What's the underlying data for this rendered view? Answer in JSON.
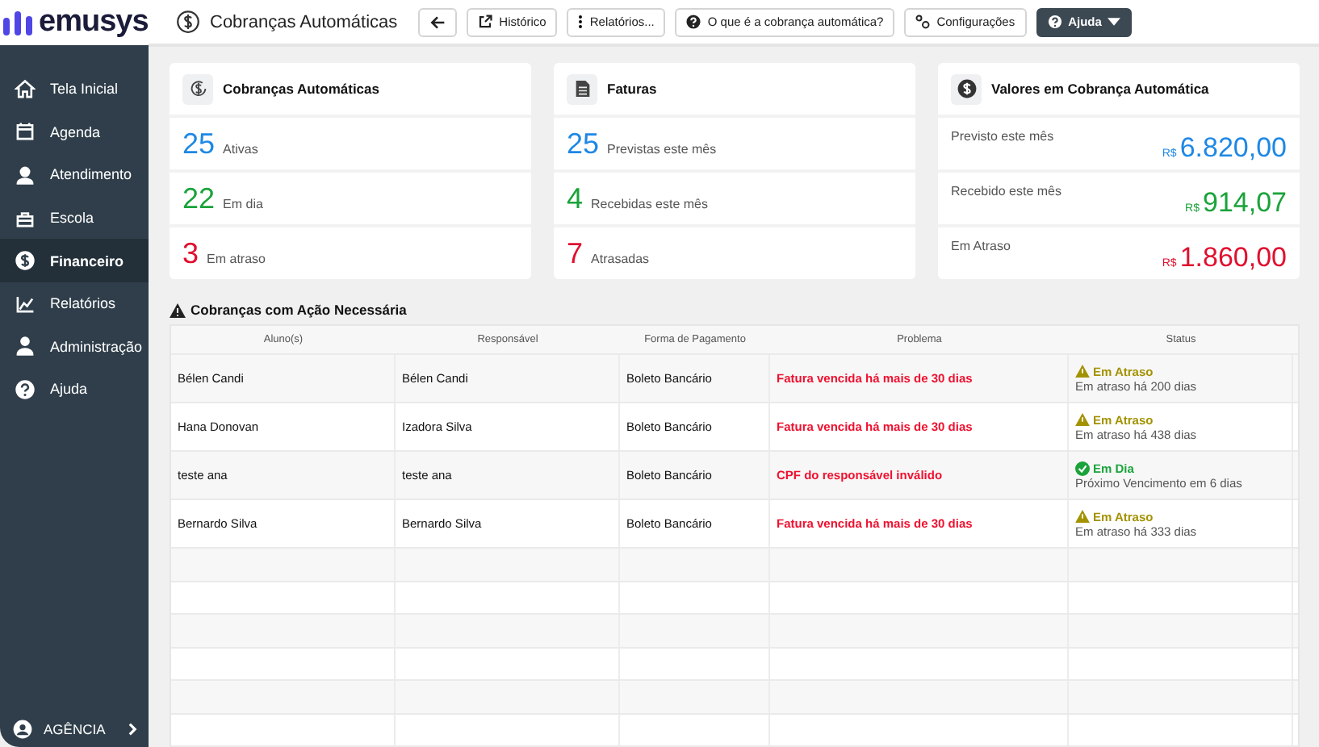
{
  "logo": "emusys",
  "sidebar": {
    "items": [
      {
        "label": "Tela Inicial",
        "selected": false
      },
      {
        "label": "Agenda",
        "selected": false
      },
      {
        "label": "Atendimento",
        "selected": false
      },
      {
        "label": "Escola",
        "selected": false
      },
      {
        "label": "Financeiro",
        "selected": true
      },
      {
        "label": "Relatórios",
        "selected": false
      },
      {
        "label": "Administração",
        "selected": false
      },
      {
        "label": "Ajuda",
        "selected": false
      }
    ],
    "footer": "AGÊNCIA"
  },
  "header": {
    "title": "Cobranças Automáticas",
    "buttons": [
      {
        "kind": "back"
      },
      {
        "kind": "plain",
        "label": "Histórico"
      },
      {
        "kind": "plain",
        "label": "Relatórios..."
      },
      {
        "kind": "plain",
        "label": "O que é a cobrança automática?"
      },
      {
        "kind": "plain",
        "label": "Configurações"
      },
      {
        "kind": "dark",
        "label": "Ajuda"
      }
    ]
  },
  "cards": [
    {
      "title": "Cobranças Automáticas",
      "kind": "count",
      "stats": [
        {
          "value": "25",
          "label": "Ativas",
          "color": "#1e88e5"
        },
        {
          "value": "22",
          "label": "Em dia",
          "color": "#1aa33a"
        },
        {
          "value": "3",
          "label": "Em atraso",
          "color": "#e0102f"
        }
      ]
    },
    {
      "title": "Faturas",
      "kind": "count",
      "stats": [
        {
          "value": "25",
          "label": "Previstas este mês",
          "color": "#1e88e5"
        },
        {
          "value": "4",
          "label": "Recebidas este mês",
          "color": "#1aa33a"
        },
        {
          "value": "7",
          "label": "Atrasadas",
          "color": "#e0102f"
        }
      ]
    },
    {
      "title": "Valores em Cobrança Automática",
      "kind": "money",
      "stats": [
        {
          "label": "Previsto este mês",
          "currency": "R$",
          "value": "6.820,00",
          "color": "#1e88e5"
        },
        {
          "label": "Recebido este mês",
          "currency": "R$",
          "value": "914,07",
          "color": "#1aa33a"
        },
        {
          "label": "Em Atraso",
          "currency": "R$",
          "value": "1.860,00",
          "color": "#e0102f"
        }
      ]
    }
  ],
  "table": {
    "title": "Cobranças com Ação Necessária",
    "columns": [
      "Aluno(s)",
      "Responsável",
      "Forma de Pagamento",
      "Problema",
      "Status"
    ],
    "rows": [
      {
        "student": "Bélen Candi",
        "guardian": "Bélen Candi",
        "payment": "Boleto Bancário",
        "problem": "Fatura vencida há mais de 30 dias",
        "status": {
          "kind": "late",
          "label": "Em Atraso",
          "detail": "Em atraso há 200 dias"
        }
      },
      {
        "student": "Hana Donovan",
        "guardian": "Izadora Silva",
        "payment": "Boleto Bancário",
        "problem": "Fatura vencida há mais de 30 dias",
        "status": {
          "kind": "late",
          "label": "Em Atraso",
          "detail": "Em atraso há 438 dias"
        }
      },
      {
        "student": "teste ana",
        "guardian": "teste ana",
        "payment": "Boleto Bancário",
        "problem": "CPF do responsável inválido",
        "status": {
          "kind": "ok",
          "label": "Em Dia",
          "detail": "Próximo Vencimento em 6 dias"
        }
      },
      {
        "student": "Bernardo Silva",
        "guardian": "Bernardo Silva",
        "payment": "Boleto Bancário",
        "problem": "Fatura vencida há mais de 30 dias",
        "status": {
          "kind": "late",
          "label": "Em Atraso",
          "detail": "Em atraso há 333 dias"
        }
      }
    ]
  }
}
